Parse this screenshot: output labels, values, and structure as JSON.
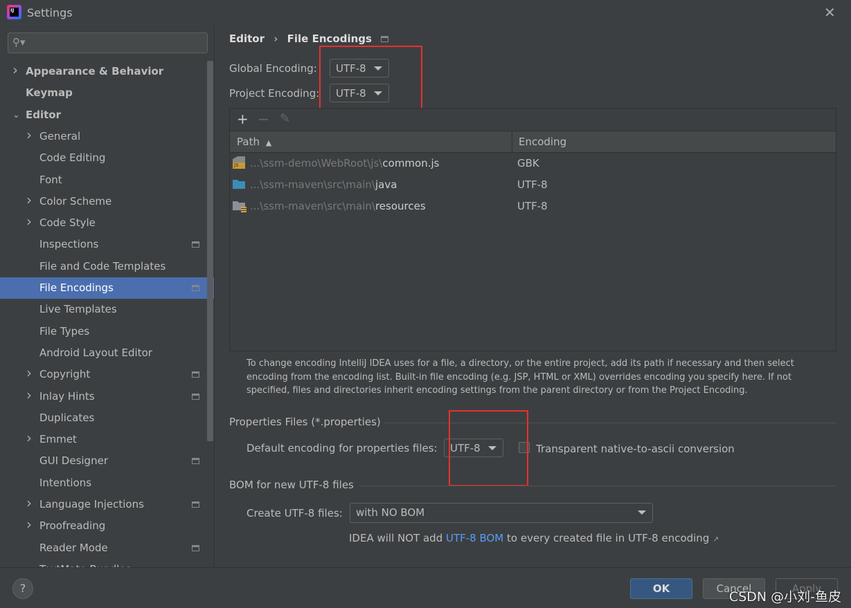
{
  "window": {
    "title": "Settings",
    "close_icon": "close-icon"
  },
  "sidebar": {
    "search_placeholder": "",
    "items": [
      {
        "label": "Appearance & Behavior",
        "level": 0,
        "chevron": "right",
        "bold": true
      },
      {
        "label": "Keymap",
        "level": 0,
        "chevron": "",
        "bold": true
      },
      {
        "label": "Editor",
        "level": 0,
        "chevron": "down",
        "bold": true
      },
      {
        "label": "General",
        "level": 1,
        "chevron": "right"
      },
      {
        "label": "Code Editing",
        "level": 1,
        "chevron": ""
      },
      {
        "label": "Font",
        "level": 1,
        "chevron": ""
      },
      {
        "label": "Color Scheme",
        "level": 1,
        "chevron": "right"
      },
      {
        "label": "Code Style",
        "level": 1,
        "chevron": "right"
      },
      {
        "label": "Inspections",
        "level": 1,
        "chevron": "",
        "project": true
      },
      {
        "label": "File and Code Templates",
        "level": 1,
        "chevron": ""
      },
      {
        "label": "File Encodings",
        "level": 1,
        "chevron": "",
        "project": true,
        "selected": true
      },
      {
        "label": "Live Templates",
        "level": 1,
        "chevron": ""
      },
      {
        "label": "File Types",
        "level": 1,
        "chevron": ""
      },
      {
        "label": "Android Layout Editor",
        "level": 1,
        "chevron": ""
      },
      {
        "label": "Copyright",
        "level": 1,
        "chevron": "right",
        "project": true
      },
      {
        "label": "Inlay Hints",
        "level": 1,
        "chevron": "right",
        "project": true
      },
      {
        "label": "Duplicates",
        "level": 1,
        "chevron": ""
      },
      {
        "label": "Emmet",
        "level": 1,
        "chevron": "right"
      },
      {
        "label": "GUI Designer",
        "level": 1,
        "chevron": "",
        "project": true
      },
      {
        "label": "Intentions",
        "level": 1,
        "chevron": ""
      },
      {
        "label": "Language Injections",
        "level": 1,
        "chevron": "right",
        "project": true
      },
      {
        "label": "Proofreading",
        "level": 1,
        "chevron": "right"
      },
      {
        "label": "Reader Mode",
        "level": 1,
        "chevron": "",
        "project": true
      },
      {
        "label": "TextMate Bundles",
        "level": 1,
        "chevron": ""
      }
    ]
  },
  "breadcrumb": {
    "parent": "Editor",
    "sep": "›",
    "current": "File Encodings"
  },
  "global_encoding": {
    "label": "Global Encoding:",
    "value": "UTF-8"
  },
  "project_encoding": {
    "label": "Project Encoding:",
    "value": "UTF-8"
  },
  "table": {
    "toolbar": {
      "add": "+",
      "remove": "−",
      "edit": "✎"
    },
    "columns": [
      "Path",
      "Encoding"
    ],
    "rows": [
      {
        "icon": "js-file-icon",
        "prefix": "...\\ssm-demo\\WebRoot\\js\\",
        "name": "common.js",
        "encoding": "GBK"
      },
      {
        "icon": "folder-icon",
        "prefix": "...\\ssm-maven\\src\\main\\",
        "name": "java",
        "encoding": "UTF-8"
      },
      {
        "icon": "resources-folder-icon",
        "prefix": "...\\ssm-maven\\src\\main\\",
        "name": "resources",
        "encoding": "UTF-8"
      }
    ]
  },
  "hint": "To change encoding IntelliJ IDEA uses for a file, a directory, or the entire project, add its path if necessary and then select encoding from the encoding list. Built-in file encoding (e.g. JSP, HTML or XML) overrides encoding you specify here. If not specified, files and directories inherit encoding settings from the parent directory or from the Project Encoding.",
  "properties": {
    "section": "Properties Files (*.properties)",
    "label": "Default encoding for properties files:",
    "value": "UTF-8",
    "checkbox_label": "Transparent native-to-ascii conversion",
    "checked": false
  },
  "bom": {
    "section": "BOM for new UTF-8 files",
    "label": "Create UTF-8 files:",
    "value": "with NO BOM",
    "note_pre": "IDEA will NOT add ",
    "note_link": "UTF-8 BOM",
    "note_post": " to every created file in UTF-8 encoding",
    "note_arrow": "↗"
  },
  "footer": {
    "help": "?",
    "ok": "OK",
    "cancel": "Cancel",
    "apply": "Apply",
    "watermark": "CSDN @小刘-鱼皮"
  },
  "colors": {
    "selection": "#4b6eaf",
    "annotation": "#e8312f",
    "link": "#589df6",
    "ok_button": "#365880"
  }
}
